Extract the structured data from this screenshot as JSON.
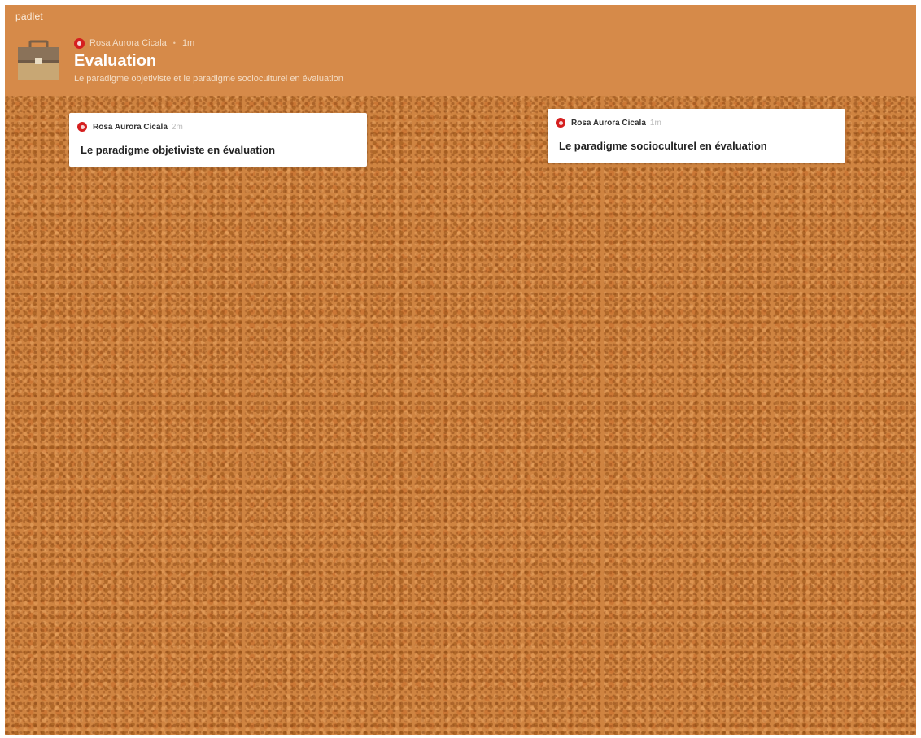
{
  "app": {
    "brand": "padlet"
  },
  "board": {
    "icon": "briefcase-icon",
    "author": "Rosa Aurora Cicala",
    "separator": "•",
    "time": "1m",
    "title": "Evaluation",
    "description": "Le paradigme objetiviste et le paradigme socioculturel en évaluation"
  },
  "posts": [
    {
      "author": "Rosa Aurora Cicala",
      "time": "2m",
      "title": "Le paradigme objetiviste en évaluation"
    },
    {
      "author": "Rosa Aurora Cicala",
      "time": "1m",
      "title": "Le paradigme socioculturel en évaluation"
    }
  ],
  "colors": {
    "header": "#d68a49",
    "cork": "#cf8441",
    "avatar": "#d51f1f",
    "card": "#ffffff"
  }
}
